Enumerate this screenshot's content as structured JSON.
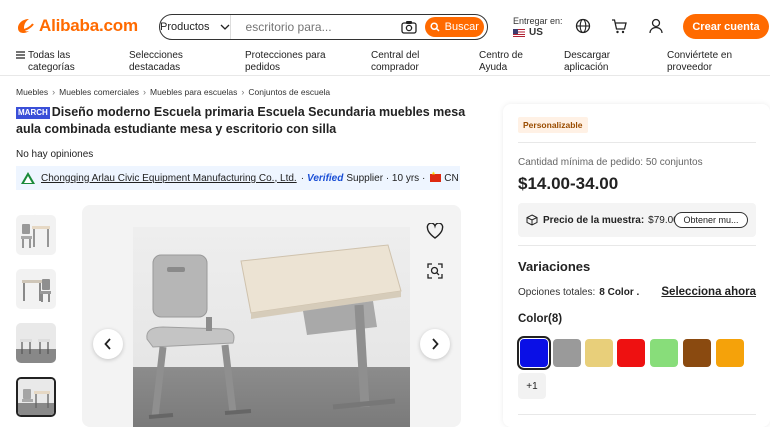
{
  "header": {
    "logo_text": "Alibaba.com",
    "search_category": "Productos",
    "search_placeholder": "escritorio para...",
    "search_button": "Buscar",
    "deliver_label": "Entregar en:",
    "deliver_country": "US",
    "create_account": "Crear cuenta",
    "brand_color": "#ff6a00"
  },
  "nav": {
    "items": [
      "Todas las\ncategorías",
      "Selecciones\ndestacadas",
      "Protecciones para\npedidos",
      "Central del\ncomprador",
      "Centro de\nAyuda",
      "Descargar\naplicación",
      "Conviértete en\nproveedor"
    ]
  },
  "breadcrumb": [
    "Muebles",
    "Muebles comerciales",
    "Muebles para escuelas",
    "Conjuntos de escuela"
  ],
  "product": {
    "badge": "MARCH",
    "title": "Diseño moderno Escuela primaria Escuela Secundaria muebles mesa aula combinada estudiante mesa y escritorio con silla",
    "reviews": "No hay opiniones",
    "supplier_name": "Chongqing Arlau Civic Equipment Manufacturing Co., Ltd.",
    "verified": "Verified",
    "supplier_suffix": "Supplier · 10 yrs ·",
    "country": "CN"
  },
  "panel": {
    "custom_badge": "Personalizable",
    "moq": "Cantidad mínima de pedido: 50 conjuntos",
    "price": "$14.00-34.00",
    "sample_label": "Precio de la muestra:",
    "sample_price": "$79.00",
    "sample_button": "Obtener mu...",
    "variations_title": "Variaciones",
    "options_label": "Opciones totales:",
    "options_value": "8 Color .",
    "select_now": "Selecciona ahora",
    "color_title": "Color(8)",
    "swatches": [
      "#0a0fe6",
      "#9a9a9a",
      "#e8cf7a",
      "#ee1111",
      "#88dd7a",
      "#8a4a10",
      "#f5a20a"
    ],
    "more": "+1"
  }
}
